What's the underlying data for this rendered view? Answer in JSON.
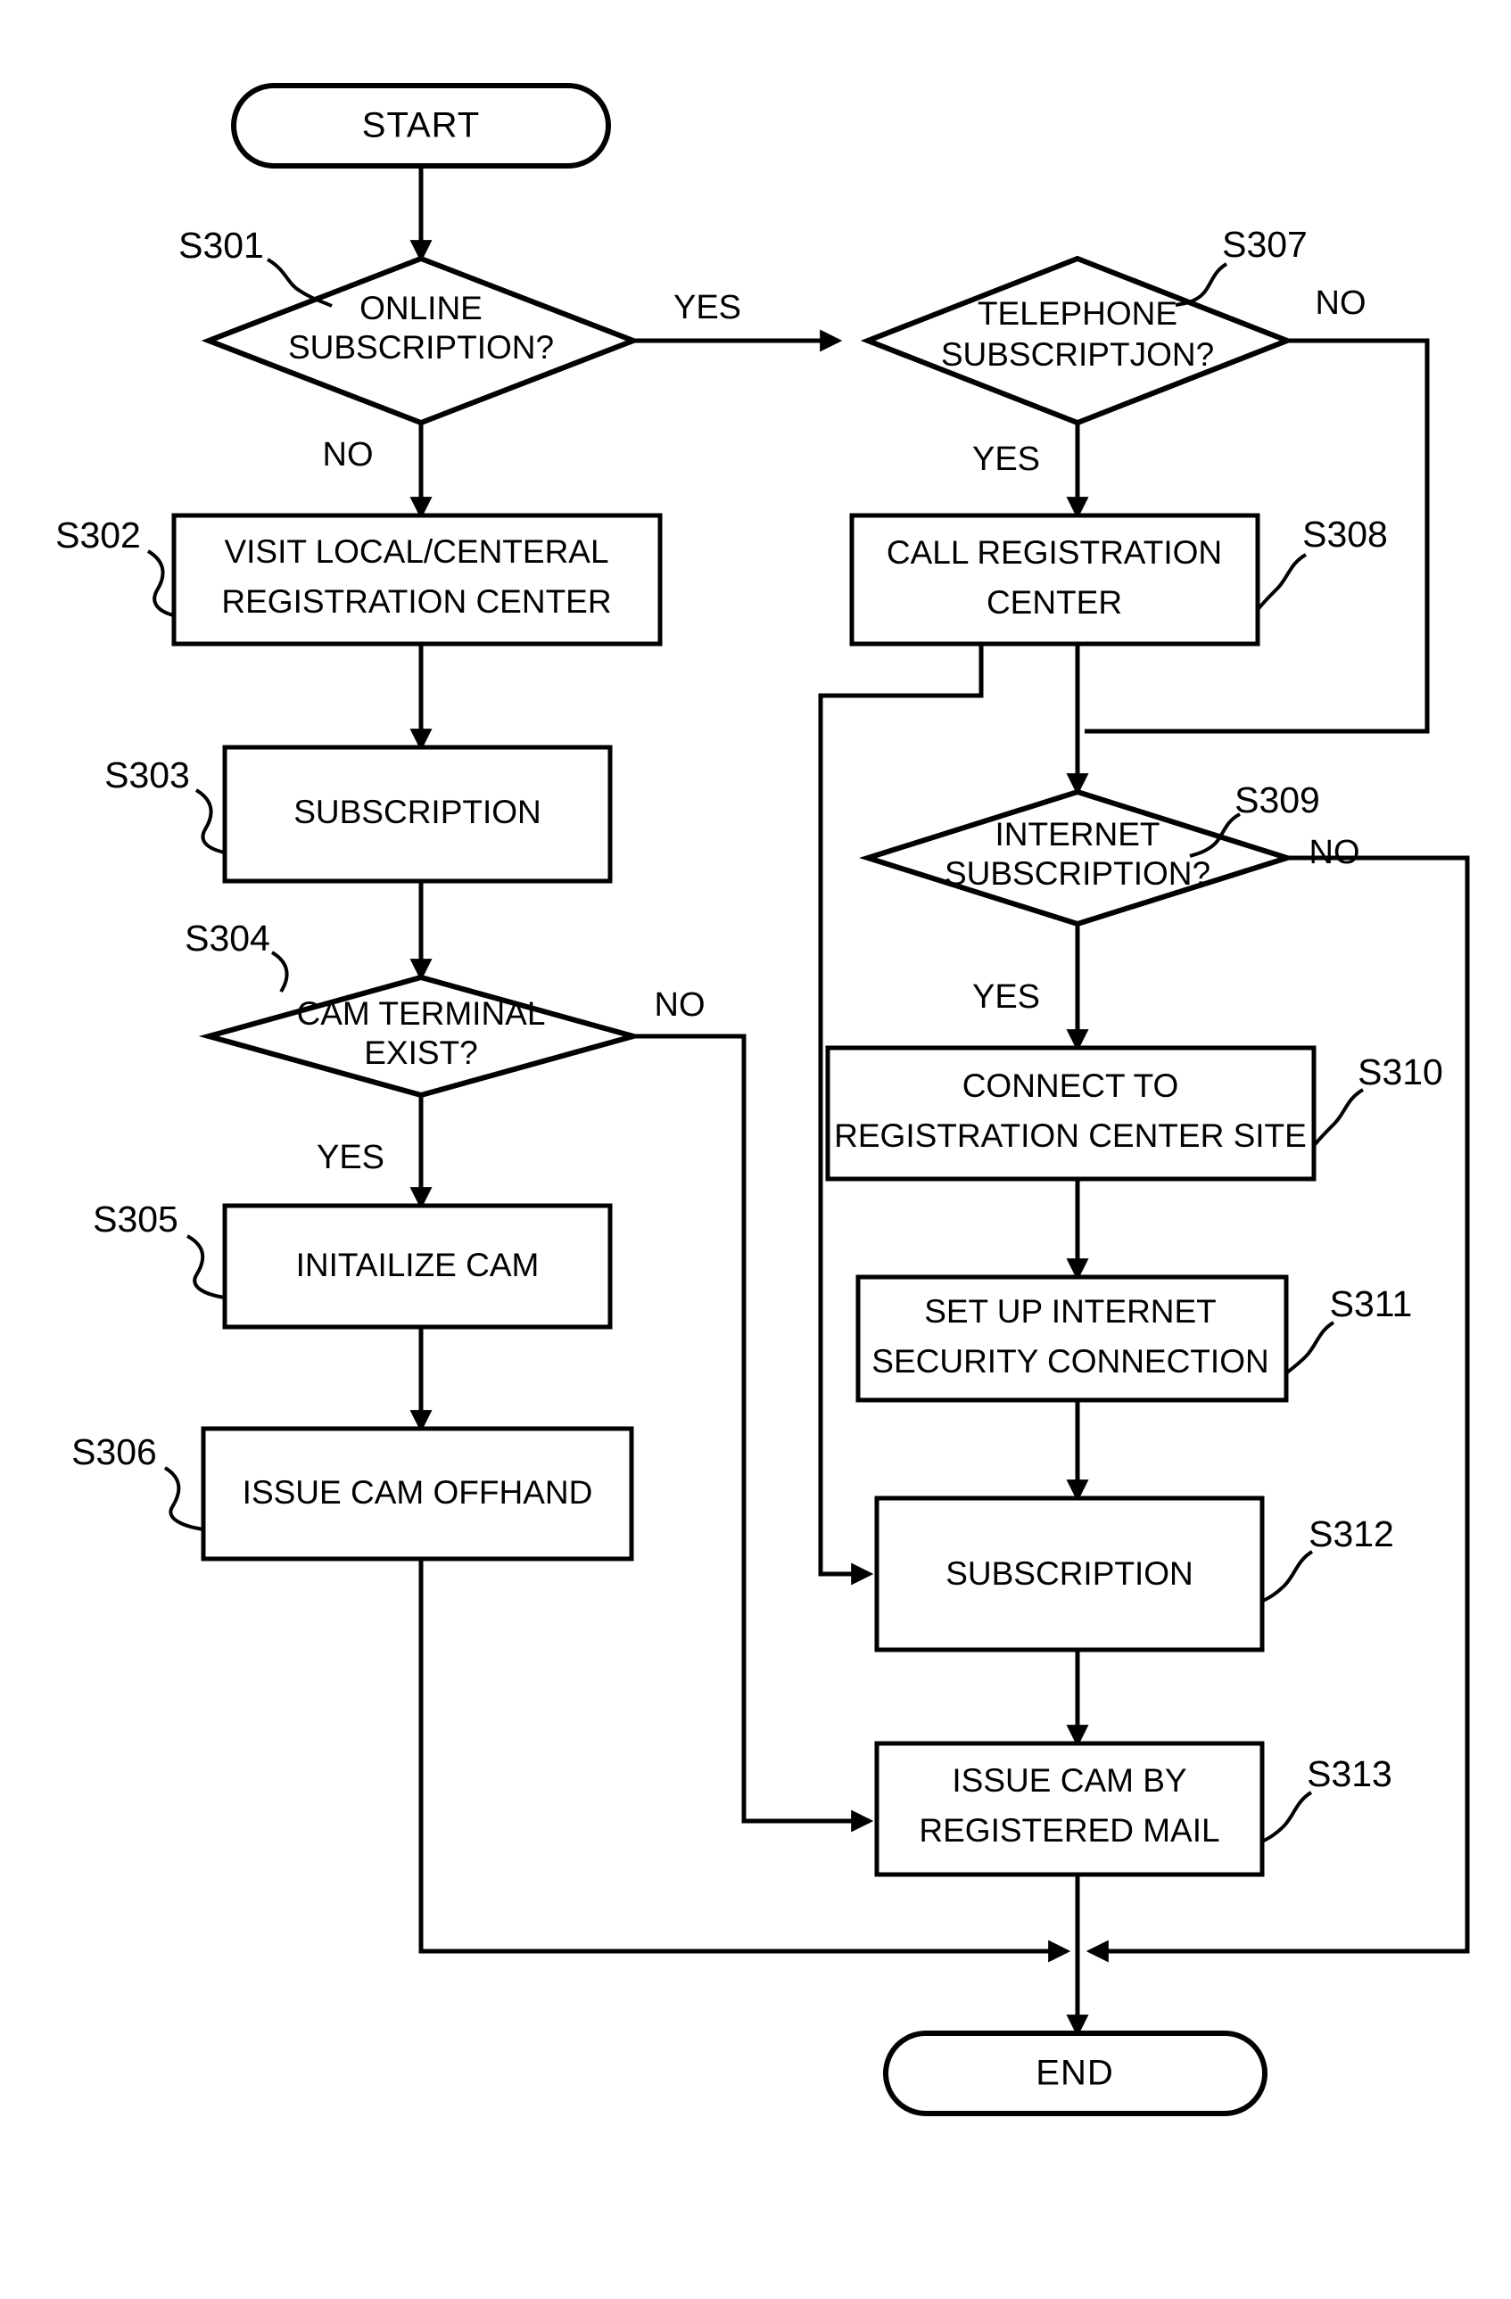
{
  "diagram": {
    "type": "flowchart",
    "title": "CAM subscription and issuance process flowchart",
    "terminals": {
      "start": "START",
      "end": "END"
    },
    "edge_labels": {
      "s301_yes": "YES",
      "s301_no": "NO",
      "s307_no": "NO",
      "s307_yes": "YES",
      "s304_no": "NO",
      "s304_yes": "YES",
      "s309_no": "NO",
      "s309_yes": "YES"
    },
    "steps": [
      {
        "id": "S301",
        "shape": "decision",
        "line1": "ONLINE",
        "line2": "SUBSCRIPTION?"
      },
      {
        "id": "S302",
        "shape": "process",
        "line1": "VISIT LOCAL/CENTERAL",
        "line2": "REGISTRATION CENTER"
      },
      {
        "id": "S303",
        "shape": "process",
        "line1": "SUBSCRIPTION",
        "line2": ""
      },
      {
        "id": "S304",
        "shape": "decision",
        "line1": "CAM TERMINAL",
        "line2": "EXIST?"
      },
      {
        "id": "S305",
        "shape": "process",
        "line1": "INITAILIZE CAM",
        "line2": ""
      },
      {
        "id": "S306",
        "shape": "process",
        "line1": "ISSUE CAM OFFHAND",
        "line2": ""
      },
      {
        "id": "S307",
        "shape": "decision",
        "line1": "TELEPHONE",
        "line2": "SUBSCRIPTJON?"
      },
      {
        "id": "S308",
        "shape": "process",
        "line1": "CALL REGISTRATION",
        "line2": "CENTER"
      },
      {
        "id": "S309",
        "shape": "decision",
        "line1": "INTERNET",
        "line2": "SUBSCRIPTION?"
      },
      {
        "id": "S310",
        "shape": "process",
        "line1": "CONNECT TO",
        "line2": "REGISTRATION CENTER SITE"
      },
      {
        "id": "S311",
        "shape": "process",
        "line1": "SET UP INTERNET",
        "line2": "SECURITY CONNECTION"
      },
      {
        "id": "S312",
        "shape": "process",
        "line1": "SUBSCRIPTION",
        "line2": ""
      },
      {
        "id": "S313",
        "shape": "process",
        "line1": "ISSUE CAM BY",
        "line2": "REGISTERED MAIL"
      }
    ],
    "colors": {
      "stroke": "#000000",
      "fill": "#ffffff",
      "background": "#ffffff"
    }
  }
}
